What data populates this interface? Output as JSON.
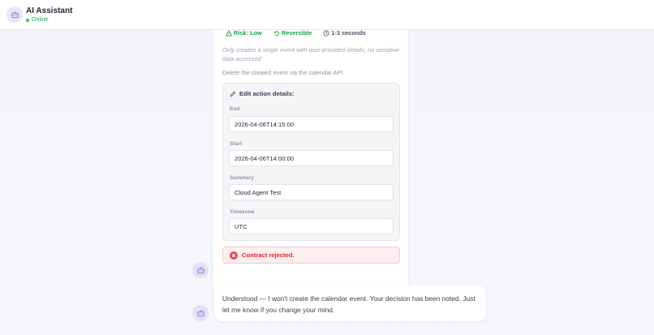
{
  "header": {
    "title": "AI Assistant",
    "status": "Online"
  },
  "action": {
    "risk_label": "Risk: Low",
    "reversible_label": "Reversible",
    "duration_label": "1-3 seconds",
    "description": "Only creates a single event with user-provided details; no sensitive data accessed",
    "rollback": "Delete the created event via the calendar API"
  },
  "edit_panel": {
    "title": "Edit action details:",
    "fields": [
      {
        "label": "End",
        "value": "2026-04-06T14:15:00"
      },
      {
        "label": "Start",
        "value": "2026-04-06T14:00:00"
      },
      {
        "label": "Summary",
        "value": "Cloud Agent Test"
      },
      {
        "label": "Timezone",
        "value": "UTC"
      }
    ]
  },
  "rejection": {
    "text": "Contract rejected."
  },
  "reply": {
    "text": "Understood — I won't create the calendar event. Your decision has been noted. Just let me know if you change your mind."
  },
  "colors": {
    "success": "#16a34a",
    "danger": "#dc2626",
    "avatar_bg": "#e2e1f6",
    "accent": "#7c6fd6"
  },
  "icons": {
    "avatar": "robot-icon",
    "risk": "warning-triangle-icon",
    "reversible": "undo-icon",
    "duration": "clock-icon",
    "edit": "pencil-icon",
    "rejected": "x-circle-icon"
  }
}
